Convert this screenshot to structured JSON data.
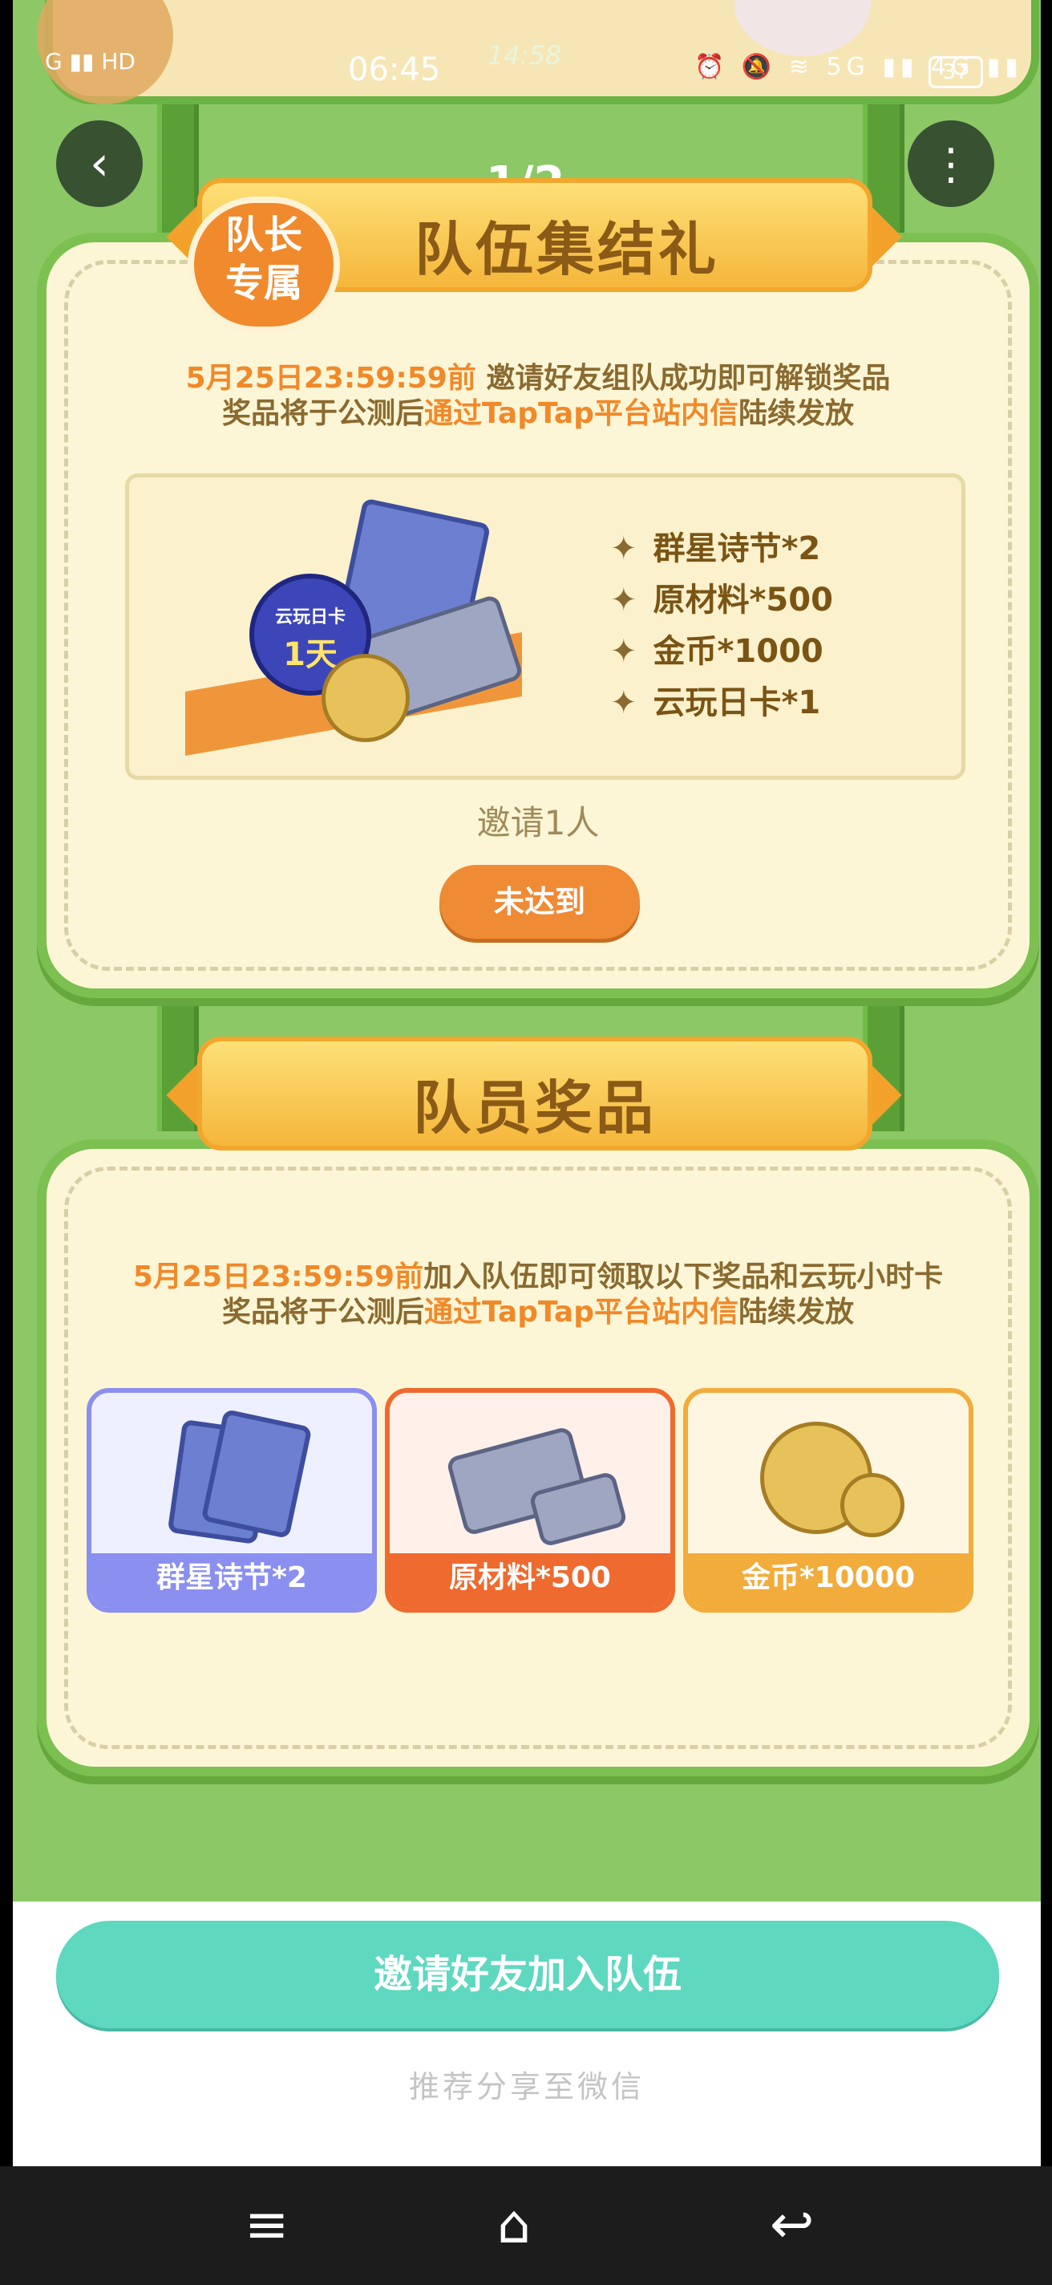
{
  "status_bar": {
    "time": "06:45",
    "secondary_time": "14:58",
    "battery": "37",
    "icons": "⏰ 🔕 ≋ 5G ▮▮ 4G ▮▮",
    "left_signal": "G ▮▮ HD"
  },
  "nav": {
    "back_icon": "‹",
    "more_icon": "⋮",
    "page_indicator": "1/2"
  },
  "captain_section": {
    "badge": "队长\n专属",
    "title": "队伍集结礼",
    "desc_line1_deadline": "5月25日23:59:59前",
    "desc_line1_rest": " 邀请好友组队成功即可解锁奖品",
    "desc_line2_pre": "奖品将于公测后",
    "desc_line2_hl": "通过TapTap平台站内信",
    "desc_line2_post": "陆续发放",
    "illustration_card_text": "云玩日卡",
    "illustration_card_num": "1天",
    "rewards": [
      {
        "label": "群星诗节*2"
      },
      {
        "label": "原材料*500"
      },
      {
        "label": "金币*1000"
      },
      {
        "label": "云玩日卡*1"
      }
    ],
    "invite_count": "邀请1人",
    "status_button": "未达到"
  },
  "member_section": {
    "title": "队员奖品",
    "desc_line1_deadline": "5月25日23:59:59前",
    "desc_line1_rest": "加入队伍即可领取以下奖品和云玩小时卡",
    "desc_line2_pre": "奖品将于公测后",
    "desc_line2_hl": "通过TapTap平台站内信",
    "desc_line2_post": "陆续发放",
    "tiles": [
      {
        "label": "群星诗节*2",
        "color": "#8a8ff0"
      },
      {
        "label": "原材料*500",
        "color": "#ef6a2e"
      },
      {
        "label": "金币*10000",
        "color": "#f2ac3c"
      }
    ]
  },
  "bottom": {
    "cta": "邀请好友加入队伍",
    "share": "推荐分享至微信"
  },
  "system_nav": {
    "menu_icon": "≡",
    "home_icon": "⌂",
    "back_icon": "↩"
  }
}
